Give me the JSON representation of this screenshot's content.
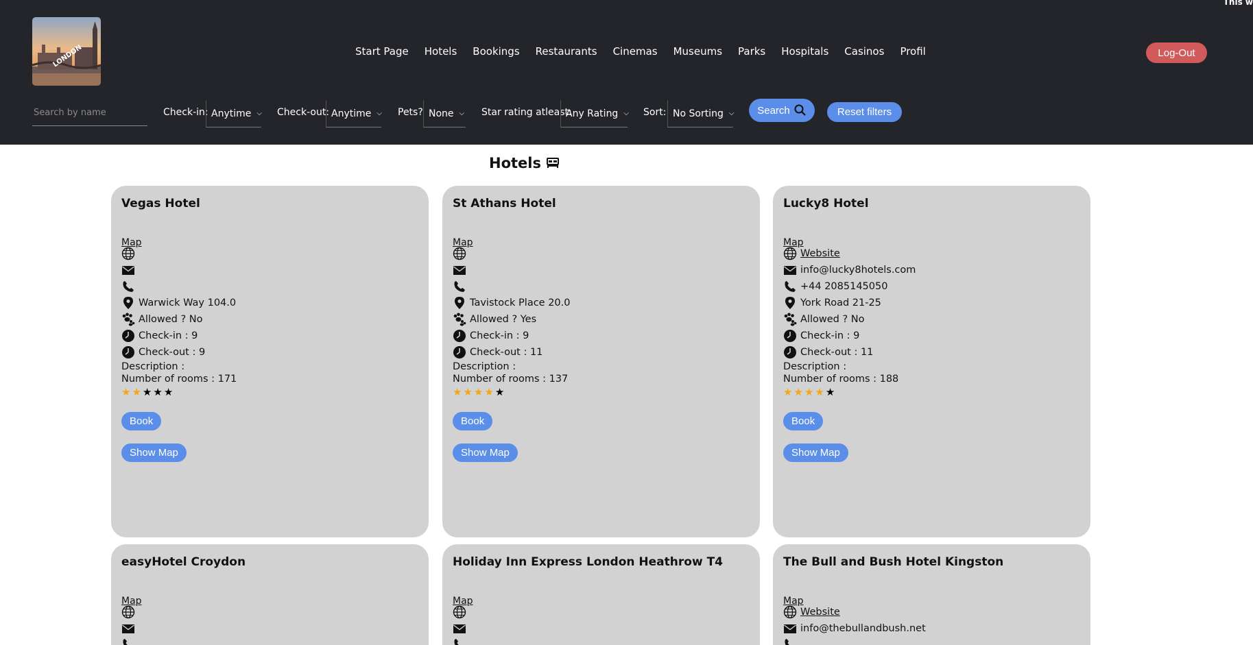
{
  "corner_text": "This w",
  "nav": [
    "Start Page",
    "Hotels",
    "Bookings",
    "Restaurants",
    "Cinemas",
    "Museums",
    "Parks",
    "Hospitals",
    "Casinos",
    "Profil"
  ],
  "logout_label": "Log-Out",
  "filters": {
    "search_placeholder": "Search by name",
    "checkin_label": "Check-in:",
    "checkin_value": "Anytime",
    "checkout_label": "Check-out:",
    "checkout_value": "Anytime",
    "pets_label": "Pets?",
    "pets_value": "None",
    "star_label": "Star rating atleast:",
    "star_value": "Any Rating",
    "sort_label": "Sort:",
    "sort_value": "No Sorting",
    "search_button": "Search",
    "reset_button": "Reset filters"
  },
  "page_title": "Hotels",
  "labels": {
    "map": "Map",
    "description": "Description :",
    "book": "Book",
    "show_map": "Show Map"
  },
  "colors": {
    "header_bg": "#24252b",
    "accent": "#5b8ee8",
    "logout": "#d15b5b",
    "card_bg": "#d2d2d2",
    "star_on": "#f5a516"
  },
  "hotels": [
    {
      "name": "Vegas Hotel",
      "website": "",
      "email": "",
      "phone": "",
      "address": "Warwick Way 104.0",
      "pets": "Allowed ? No",
      "checkin": "Check-in : 9",
      "checkout": "Check-out : 9",
      "rooms": "Number of rooms : 171",
      "stars": 2
    },
    {
      "name": "St Athans Hotel",
      "website": "",
      "email": "",
      "phone": "",
      "address": "Tavistock Place 20.0",
      "pets": "Allowed ? Yes",
      "checkin": "Check-in : 9",
      "checkout": "Check-out : 11",
      "rooms": "Number of rooms : 137",
      "stars": 4
    },
    {
      "name": "Lucky8 Hotel",
      "website": "Website",
      "email": "info@lucky8hotels.com",
      "phone": "+44 2085145050",
      "address": "York Road 21-25",
      "pets": "Allowed ? No",
      "checkin": "Check-in : 9",
      "checkout": "Check-out : 11",
      "rooms": "Number of rooms : 188",
      "stars": 4
    },
    {
      "name": "easyHotel Croydon",
      "website": "",
      "email": "",
      "phone": ""
    },
    {
      "name": "Holiday Inn Express London Heathrow T4",
      "website": "",
      "email": "",
      "phone": ""
    },
    {
      "name": "The Bull and Bush Hotel Kingston",
      "website": "Website",
      "email": "info@thebullandbush.net",
      "phone": ""
    }
  ]
}
